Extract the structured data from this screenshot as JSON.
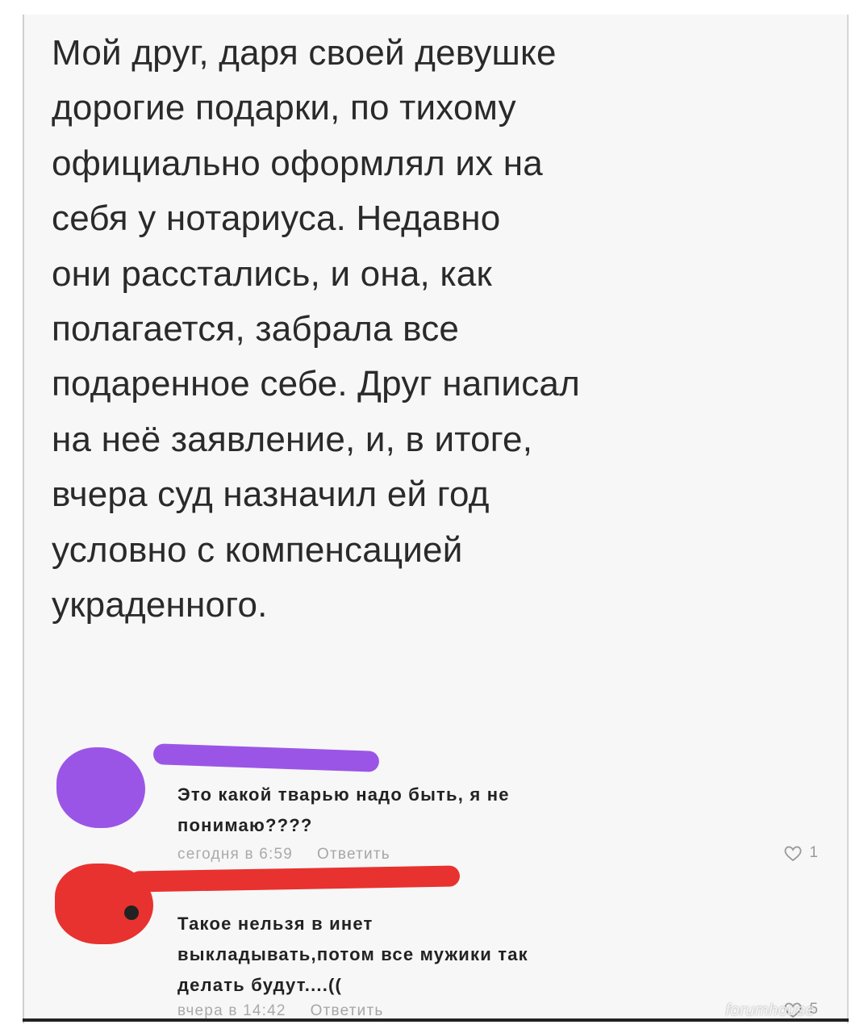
{
  "post": {
    "lines": [
      "Мой друг, даря своей девушке",
      "дорогие подарки, по тихому",
      "официально оформлял их на",
      "себя у нотариуса. Недавно",
      "они расстались, и она, как",
      "полагается, забрала все",
      "подаренное себе. Друг написал",
      "на неё заявление, и, в итоге,",
      "вчера суд назначил ей год",
      "условно с компенсацией",
      "украденного."
    ]
  },
  "comments": [
    {
      "text_lines": [
        "Это какой тварью надо быть, я не",
        "понимаю????"
      ],
      "time": "сегодня в 6:59",
      "reply": "Ответить",
      "likes": "1",
      "redaction_color": "#9b55e6"
    },
    {
      "text_lines": [
        "Такое нельзя в инет",
        "выкладывать,потом все мужики так",
        "делать будут....(("
      ],
      "time": "вчера в 14:42",
      "reply": "Ответить",
      "likes": "5",
      "redaction_color": "#e8322f"
    }
  ],
  "icons": {
    "like": "heart-icon"
  },
  "watermark": "forumhouse"
}
